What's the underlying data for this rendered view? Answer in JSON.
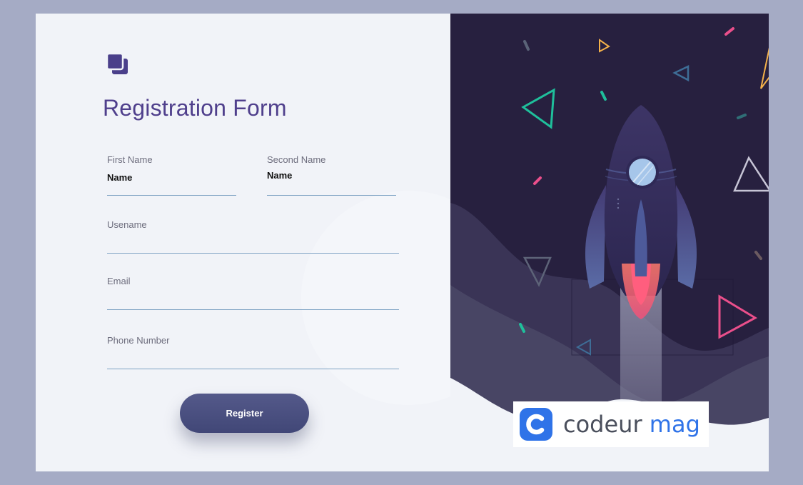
{
  "form": {
    "title": "Registration Form",
    "first_name": {
      "label": "First Name",
      "value": "Name"
    },
    "second_name": {
      "label": "Second Name",
      "value": "Name"
    },
    "username": {
      "label": "Usename",
      "value": ""
    },
    "email": {
      "label": "Email",
      "value": ""
    },
    "phone": {
      "label": "Phone Number",
      "value": ""
    },
    "register_label": "Register"
  },
  "watermark": {
    "part1": "codeur",
    "part2": "mag"
  },
  "colors": {
    "accent": "#4f3f8c",
    "button": "#474c7c",
    "field_line": "#7fa3c4",
    "art_background": "#27203f",
    "watermark_blue": "#2f73e8"
  },
  "icons": {
    "logo": "stacked-squares-icon",
    "art": "rocket-illustration",
    "watermark_logo": "codeur-c-icon"
  }
}
